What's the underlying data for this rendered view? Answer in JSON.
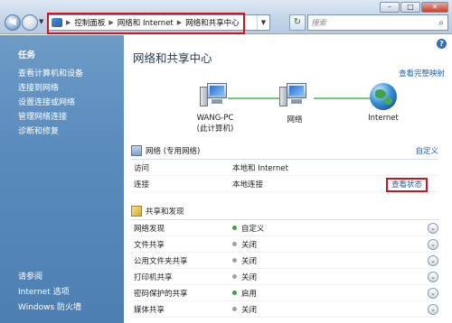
{
  "window": {
    "minimize": "–",
    "maximize": "□",
    "close": "✕"
  },
  "nav": {
    "back_icon": "back-arrow-icon",
    "forward_icon": "forward-arrow-icon"
  },
  "address": {
    "segments": [
      "控制面板",
      "网络和 Internet",
      "网络和共享中心"
    ],
    "refresh_icon": "refresh-icon"
  },
  "search": {
    "placeholder": "搜索"
  },
  "left_pane": {
    "heading": "任务",
    "tasks": [
      "查看计算机和设备",
      "连接到网络",
      "设置连接或网络",
      "管理网络连接",
      "诊断和修复"
    ],
    "see_also_heading": "请参阅",
    "see_also": [
      "Internet 选项",
      "Windows 防火墙"
    ]
  },
  "main": {
    "title": "网络和共享中心",
    "view_full_map": "查看完整映射",
    "nodes": {
      "pc_name": "WANG-PC",
      "pc_sub": "(此计算机)",
      "network": "网络",
      "internet": "Internet"
    },
    "network_section": {
      "title": "网络 (专用网络)",
      "customize": "自定义",
      "rows": [
        {
          "key": "访问",
          "value": "本地和 Internet"
        },
        {
          "key": "连接",
          "value": "本地连接",
          "action": "查看状态"
        }
      ]
    },
    "sharing_section": {
      "title": "共享和发现",
      "rows": [
        {
          "key": "网络发现",
          "value": "自定义",
          "on": true
        },
        {
          "key": "文件共享",
          "value": "关闭",
          "on": false
        },
        {
          "key": "公用文件夹共享",
          "value": "关闭",
          "on": false
        },
        {
          "key": "打印机共享",
          "value": "关闭",
          "on": false
        },
        {
          "key": "密码保护的共享",
          "value": "启用",
          "on": true
        },
        {
          "key": "媒体共享",
          "value": "关闭",
          "on": false
        }
      ]
    }
  },
  "colors": {
    "highlight_box": "#d8101a",
    "link": "#1f5fb3",
    "left_pane": "#5a8bbd",
    "status_on": "#3ea33e"
  }
}
